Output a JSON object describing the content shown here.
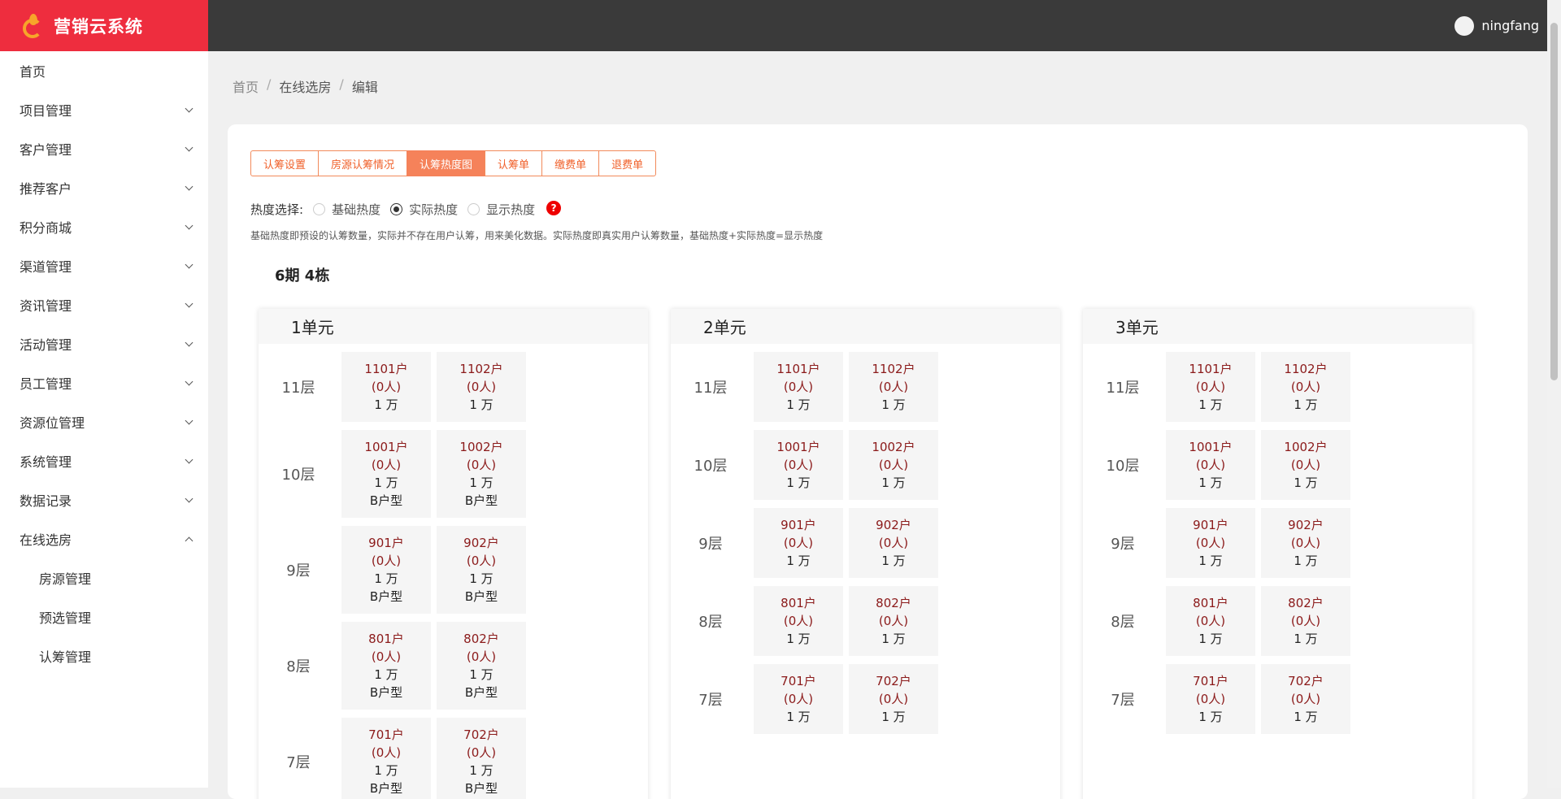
{
  "app": {
    "title": "营销云系统"
  },
  "user": {
    "name": "ningfang"
  },
  "sidebar": {
    "items": [
      {
        "label": "首页"
      },
      {
        "label": "项目管理"
      },
      {
        "label": "客户管理"
      },
      {
        "label": "推荐客户"
      },
      {
        "label": "积分商城"
      },
      {
        "label": "渠道管理"
      },
      {
        "label": "资讯管理"
      },
      {
        "label": "活动管理"
      },
      {
        "label": "员工管理"
      },
      {
        "label": "资源位管理"
      },
      {
        "label": "系统管理"
      },
      {
        "label": "数据记录"
      },
      {
        "label": "在线选房"
      }
    ],
    "subitems": [
      {
        "label": "房源管理"
      },
      {
        "label": "预选管理"
      },
      {
        "label": "认筹管理"
      }
    ]
  },
  "breadcrumb": {
    "home": "首页",
    "section": "在线选房",
    "current": "编辑",
    "sep": "/"
  },
  "tabs": [
    {
      "label": "认筹设置"
    },
    {
      "label": "房源认筹情况"
    },
    {
      "label": "认筹热度图"
    },
    {
      "label": "认筹单"
    },
    {
      "label": "缴费单"
    },
    {
      "label": "退费单"
    }
  ],
  "heat": {
    "label": "热度选择:",
    "options": [
      {
        "label": "基础热度",
        "checked": false
      },
      {
        "label": "实际热度",
        "checked": true
      },
      {
        "label": "显示热度",
        "checked": false
      }
    ],
    "help": "?",
    "note": "基础热度即预设的认筹数量，实际并不存在用户认筹，用来美化数据。实际热度即真实用户认筹数量，基础热度+实际热度=显示热度"
  },
  "building": "6期 4栋",
  "units": [
    {
      "name": "1单元",
      "floors": [
        {
          "label": "11层",
          "rooms": [
            {
              "no": "1101户",
              "count": "(0人)",
              "price": "1 万",
              "type": ""
            },
            {
              "no": "1102户",
              "count": "(0人)",
              "price": "1 万",
              "type": ""
            }
          ]
        },
        {
          "label": "10层",
          "rooms": [
            {
              "no": "1001户",
              "count": "(0人)",
              "price": "1 万",
              "type": "B户型"
            },
            {
              "no": "1002户",
              "count": "(0人)",
              "price": "1 万",
              "type": "B户型"
            }
          ]
        },
        {
          "label": "9层",
          "rooms": [
            {
              "no": "901户",
              "count": "(0人)",
              "price": "1 万",
              "type": "B户型"
            },
            {
              "no": "902户",
              "count": "(0人)",
              "price": "1 万",
              "type": "B户型"
            }
          ]
        },
        {
          "label": "8层",
          "rooms": [
            {
              "no": "801户",
              "count": "(0人)",
              "price": "1 万",
              "type": "B户型"
            },
            {
              "no": "802户",
              "count": "(0人)",
              "price": "1 万",
              "type": "B户型"
            }
          ]
        },
        {
          "label": "7层",
          "rooms": [
            {
              "no": "701户",
              "count": "(0人)",
              "price": "1 万",
              "type": "B户型"
            },
            {
              "no": "702户",
              "count": "(0人)",
              "price": "1 万",
              "type": "B户型"
            }
          ]
        }
      ]
    },
    {
      "name": "2单元",
      "floors": [
        {
          "label": "11层",
          "rooms": [
            {
              "no": "1101户",
              "count": "(0人)",
              "price": "1 万",
              "type": ""
            },
            {
              "no": "1102户",
              "count": "(0人)",
              "price": "1 万",
              "type": ""
            }
          ]
        },
        {
          "label": "10层",
          "rooms": [
            {
              "no": "1001户",
              "count": "(0人)",
              "price": "1 万",
              "type": ""
            },
            {
              "no": "1002户",
              "count": "(0人)",
              "price": "1 万",
              "type": ""
            }
          ]
        },
        {
          "label": "9层",
          "rooms": [
            {
              "no": "901户",
              "count": "(0人)",
              "price": "1 万",
              "type": ""
            },
            {
              "no": "902户",
              "count": "(0人)",
              "price": "1 万",
              "type": ""
            }
          ]
        },
        {
          "label": "8层",
          "rooms": [
            {
              "no": "801户",
              "count": "(0人)",
              "price": "1 万",
              "type": ""
            },
            {
              "no": "802户",
              "count": "(0人)",
              "price": "1 万",
              "type": ""
            }
          ]
        },
        {
          "label": "7层",
          "rooms": [
            {
              "no": "701户",
              "count": "(0人)",
              "price": "1 万",
              "type": ""
            },
            {
              "no": "702户",
              "count": "(0人)",
              "price": "1 万",
              "type": ""
            }
          ]
        }
      ]
    },
    {
      "name": "3单元",
      "floors": [
        {
          "label": "11层",
          "rooms": [
            {
              "no": "1101户",
              "count": "(0人)",
              "price": "1 万",
              "type": ""
            },
            {
              "no": "1102户",
              "count": "(0人)",
              "price": "1 万",
              "type": ""
            }
          ]
        },
        {
          "label": "10层",
          "rooms": [
            {
              "no": "1001户",
              "count": "(0人)",
              "price": "1 万",
              "type": ""
            },
            {
              "no": "1002户",
              "count": "(0人)",
              "price": "1 万",
              "type": ""
            }
          ]
        },
        {
          "label": "9层",
          "rooms": [
            {
              "no": "901户",
              "count": "(0人)",
              "price": "1 万",
              "type": ""
            },
            {
              "no": "902户",
              "count": "(0人)",
              "price": "1 万",
              "type": ""
            }
          ]
        },
        {
          "label": "8层",
          "rooms": [
            {
              "no": "801户",
              "count": "(0人)",
              "price": "1 万",
              "type": ""
            },
            {
              "no": "802户",
              "count": "(0人)",
              "price": "1 万",
              "type": ""
            }
          ]
        },
        {
          "label": "7层",
          "rooms": [
            {
              "no": "701户",
              "count": "(0人)",
              "price": "1 万",
              "type": ""
            },
            {
              "no": "702户",
              "count": "(0人)",
              "price": "1 万",
              "type": ""
            }
          ]
        }
      ]
    }
  ]
}
